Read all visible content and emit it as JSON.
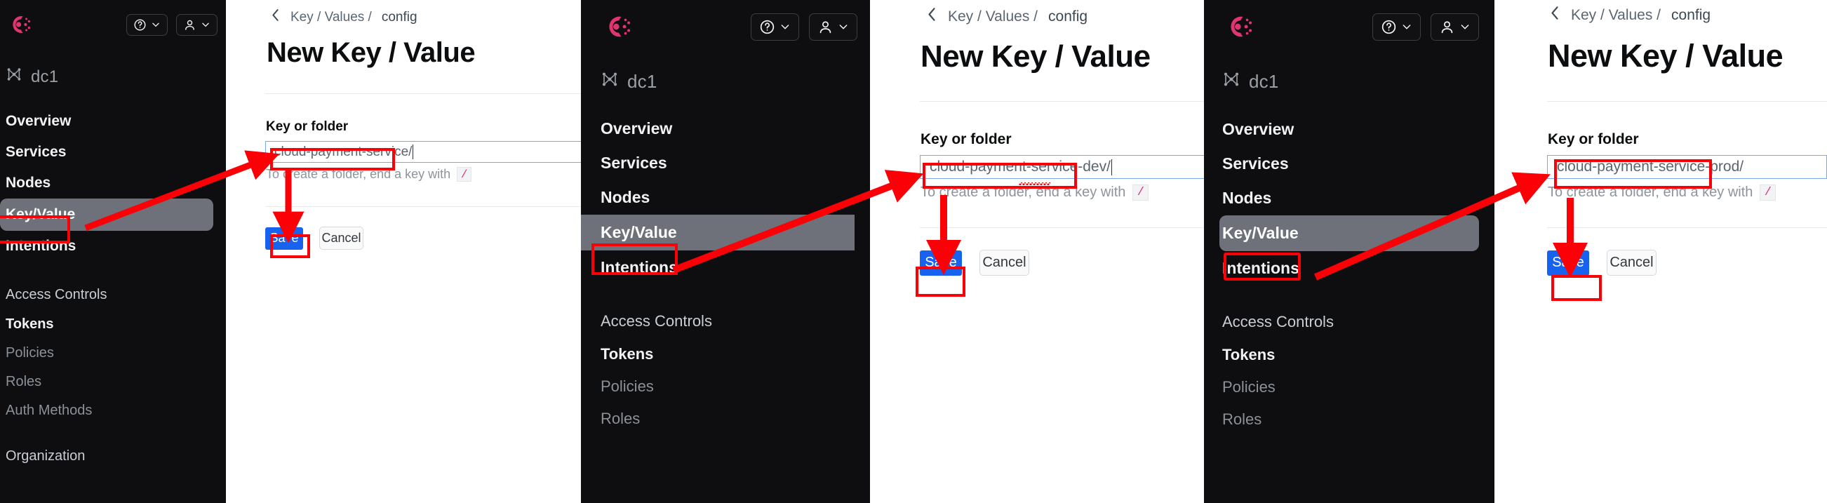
{
  "app": {
    "brand_color": "#e0356e",
    "sidebar_bg": "#0e0e10",
    "accent_blue": "#1862f0",
    "annotation_red": "#fb0007",
    "active_nav_bg": "#6e7179"
  },
  "sidebar": {
    "datacenter": "dc1",
    "help_button": {
      "icon": "question-circle-icon",
      "chevron": "chevron-down-icon"
    },
    "user_button": {
      "icon": "user-icon",
      "chevron": "chevron-down-icon"
    },
    "items": [
      {
        "label": "Overview",
        "style": "bold"
      },
      {
        "label": "Services",
        "style": "bold"
      },
      {
        "label": "Nodes",
        "style": "bold"
      },
      {
        "label": "Key/Value",
        "style": "bold",
        "active": true
      },
      {
        "label": "Intentions",
        "style": "bold"
      },
      {
        "label": "Access Controls",
        "style": "section"
      },
      {
        "label": "Tokens",
        "style": "bold"
      },
      {
        "label": "Policies",
        "style": "dim"
      },
      {
        "label": "Roles",
        "style": "dim"
      },
      {
        "label": "Auth Methods",
        "style": "dim"
      },
      {
        "label": "Organization",
        "style": "section"
      }
    ]
  },
  "breadcrumb": {
    "back_icon": "chevron-left-icon",
    "segments": [
      "Key / Values /",
      "config"
    ]
  },
  "page": {
    "title": "New Key / Value",
    "field_label": "Key or folder",
    "hint_prefix": "To create a folder, end a key with",
    "hint_badge": "/",
    "save_label": "Save",
    "cancel_label": "Cancel"
  },
  "panels": [
    {
      "key_value": "cloud-payment-service/"
    },
    {
      "key_value": "cloud-payment-service-dev/"
    },
    {
      "key_value": "cloud-payment-service-prod/"
    }
  ]
}
